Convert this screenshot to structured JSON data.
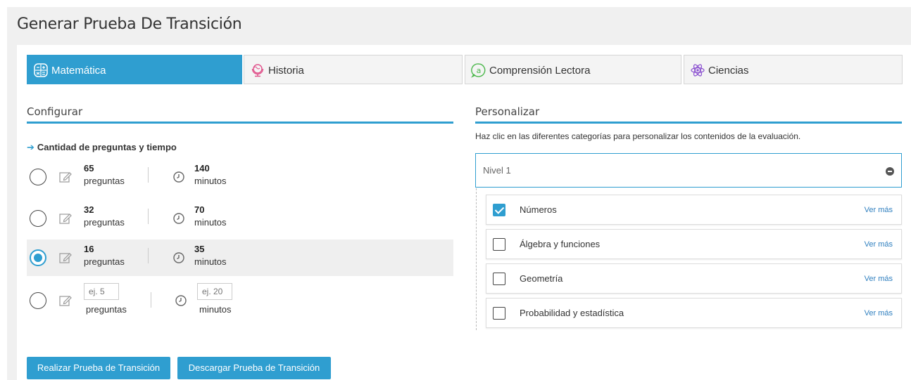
{
  "header": {
    "title": "Generar Prueba De Transición"
  },
  "tabs": [
    {
      "label": "Matemática",
      "icon": "calculator-icon",
      "active": true
    },
    {
      "label": "Historia",
      "icon": "globe-icon",
      "active": false
    },
    {
      "label": "Comprensión Lectora",
      "icon": "letter-a-icon",
      "active": false
    },
    {
      "label": "Ciencias",
      "icon": "atom-icon",
      "active": false
    }
  ],
  "configurar": {
    "title": "Configurar",
    "subhead": "Cantidad de preguntas y tiempo",
    "options": [
      {
        "preguntas": "65",
        "preguntas_label": "preguntas",
        "minutos": "140",
        "minutos_label": "minutos",
        "selected": false
      },
      {
        "preguntas": "32",
        "preguntas_label": "preguntas",
        "minutos": "70",
        "minutos_label": "minutos",
        "selected": false
      },
      {
        "preguntas": "16",
        "preguntas_label": "preguntas",
        "minutos": "35",
        "minutos_label": "minutos",
        "selected": true
      }
    ],
    "custom": {
      "preguntas_placeholder": "ej. 5",
      "preguntas_label": "preguntas",
      "minutos_placeholder": "ej. 20",
      "minutos_label": "minutos"
    }
  },
  "personalizar": {
    "title": "Personalizar",
    "note": "Haz clic en las diferentes categorías para personalizar los contenidos de la evaluación.",
    "nivel": "Nivel 1",
    "categories": [
      {
        "label": "Números",
        "checked": true,
        "link": "Ver más"
      },
      {
        "label": "Álgebra y funciones",
        "checked": false,
        "link": "Ver más"
      },
      {
        "label": "Geometría",
        "checked": false,
        "link": "Ver más"
      },
      {
        "label": "Probabilidad y estadística",
        "checked": false,
        "link": "Ver más"
      }
    ]
  },
  "buttons": {
    "realizar": "Realizar Prueba de Transición",
    "descargar": "Descargar Prueba de Transición"
  },
  "colors": {
    "accent": "#2f9ed0"
  }
}
